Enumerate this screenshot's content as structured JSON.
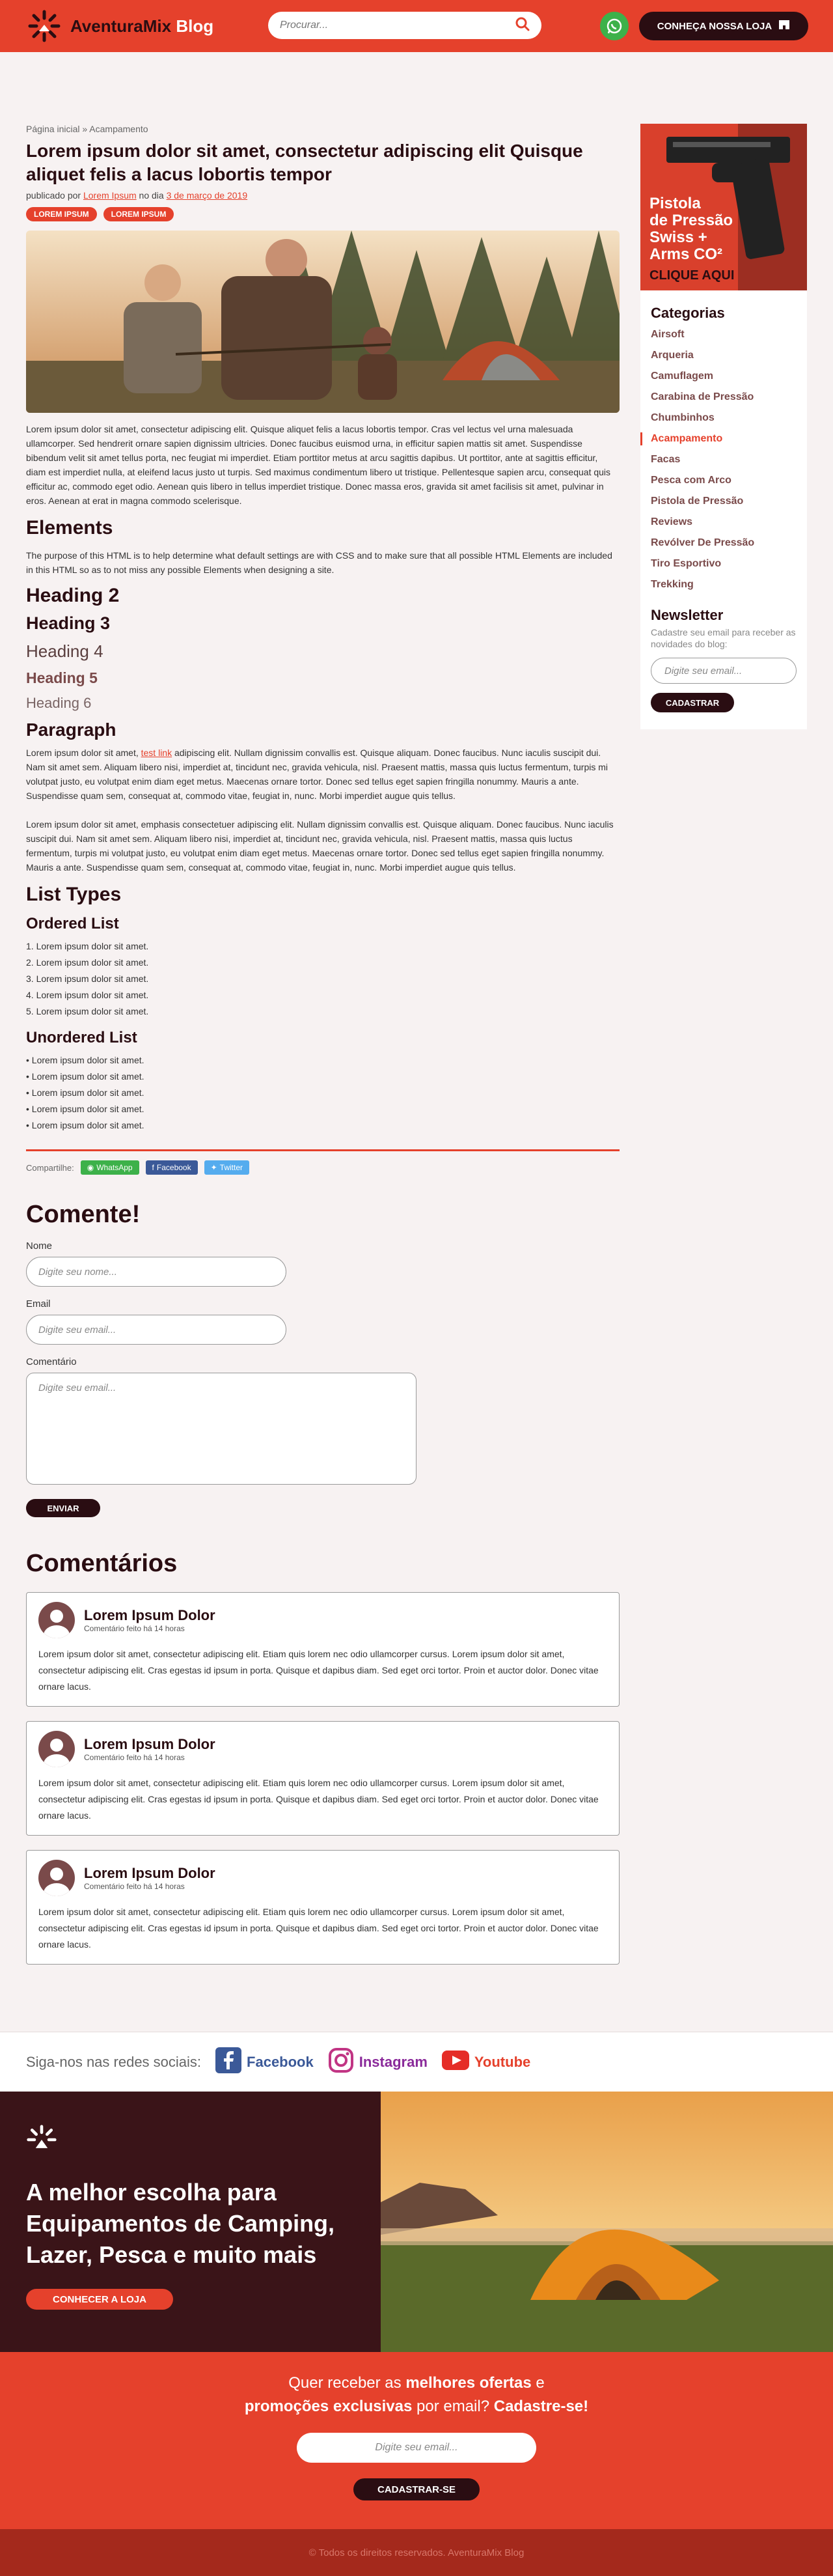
{
  "header": {
    "logo_main": "AventuraMix",
    "logo_sub": "Blog",
    "search_placeholder": "Procurar...",
    "store_button": "CONHEÇA NOSSA LOJA"
  },
  "post": {
    "breadcrumb": "Página inicial » Acampamento",
    "title": "Lorem ipsum dolor sit amet, consectetur adipiscing elit Quisque aliquet felis a lacus lobortis tempor",
    "published_prefix": "publicado por",
    "author": "Lorem Ipsum",
    "date_prefix": "no dia",
    "date": "3 de março de 2019",
    "tags": [
      "LOREM IPSUM",
      "LOREM IPSUM"
    ],
    "intro": "Lorem ipsum dolor sit amet, consectetur adipiscing elit. Quisque aliquet felis a lacus lobortis tempor. Cras vel lectus vel urna malesuada ullamcorper. Sed hendrerit ornare sapien dignissim ultricies. Donec faucibus euismod urna, in efficitur sapien mattis sit amet. Suspendisse bibendum velit sit amet tellus porta, nec feugiat mi imperdiet. Etiam porttitor metus at arcu sagittis dapibus. Ut porttitor, ante at sagittis efficitur, diam est imperdiet nulla, at eleifend lacus justo ut turpis. Sed maximus condimentum libero ut tristique. Pellentesque sapien arcu, consequat quis efficitur ac, commodo eget odio. Aenean quis libero in tellus imperdiet tristique. Donec massa eros, gravida sit amet facilisis sit amet, pulvinar in eros. Aenean at erat in magna commodo scelerisque.",
    "elements_heading": "Elements",
    "elements_text": "The purpose of this HTML is to help determine what default settings are with CSS and to make sure that all possible HTML Elements are included in this HTML so as to not miss any possible Elements when designing a site.",
    "h2": "Heading 2",
    "h3": "Heading 3",
    "h4": "Heading 4",
    "h5": "Heading 5",
    "h6": "Heading 6",
    "paragraph_heading": "Paragraph",
    "para1_before": "Lorem ipsum dolor sit amet,",
    "para1_link": "test link",
    "para1_after": "adipiscing elit. Nullam dignissim convallis est. Quisque aliquam. Donec faucibus. Nunc iaculis suscipit dui. Nam sit amet sem. Aliquam libero nisi, imperdiet at, tincidunt nec, gravida vehicula, nisl. Praesent mattis, massa quis luctus fermentum, turpis mi volutpat justo, eu volutpat enim diam eget metus. Maecenas ornare tortor. Donec sed tellus eget sapien fringilla nonummy. Mauris a ante. Suspendisse quam sem, consequat at, commodo vitae, feugiat in, nunc. Morbi imperdiet augue quis tellus.",
    "para2": "Lorem ipsum dolor sit amet, emphasis consectetuer adipiscing elit. Nullam dignissim convallis est. Quisque aliquam. Donec faucibus. Nunc iaculis suscipit dui. Nam sit amet sem. Aliquam libero nisi, imperdiet at, tincidunt nec, gravida vehicula, nisl. Praesent mattis, massa quis luctus fermentum, turpis mi volutpat justo, eu volutpat enim diam eget metus. Maecenas ornare tortor. Donec sed tellus eget sapien fringilla nonummy. Mauris a ante. Suspendisse quam sem, consequat at, commodo vitae, feugiat in, nunc. Morbi imperdiet augue quis tellus.",
    "list_types": "List Types",
    "ordered_heading": "Ordered List",
    "ordered": [
      "1. Lorem ipsum dolor sit amet.",
      "2. Lorem ipsum dolor sit amet.",
      "3. Lorem ipsum dolor sit amet.",
      "4. Lorem ipsum dolor sit amet.",
      "5. Lorem ipsum dolor sit amet."
    ],
    "unordered_heading": "Unordered List",
    "unordered": [
      "• Lorem ipsum dolor sit amet.",
      "• Lorem ipsum dolor sit amet.",
      "• Lorem ipsum dolor sit amet.",
      "• Lorem ipsum dolor sit amet.",
      "• Lorem ipsum dolor sit amet."
    ]
  },
  "share": {
    "label": "Compartilhe:",
    "whatsapp": "WhatsApp",
    "facebook": "Facebook",
    "twitter": "Twitter"
  },
  "comment_form": {
    "heading": "Comente!",
    "name_label": "Nome",
    "name_placeholder": "Digite seu nome...",
    "email_label": "Email",
    "email_placeholder": "Digite seu email...",
    "comment_label": "Comentário",
    "comment_placeholder": "Digite seu email...",
    "submit": "ENVIAR"
  },
  "comments": {
    "heading": "Comentários",
    "items": [
      {
        "name": "Lorem Ipsum Dolor",
        "time": "Comentário feito há 14 horas",
        "text": "Lorem ipsum dolor sit amet, consectetur adipiscing elit. Etiam quis lorem nec odio ullamcorper cursus. Lorem ipsum dolor sit amet, consectetur adipiscing elit. Cras egestas id ipsum in porta. Quisque et dapibus diam. Sed eget orci tortor. Proin et auctor dolor. Donec vitae ornare lacus."
      },
      {
        "name": "Lorem Ipsum Dolor",
        "time": "Comentário feito há 14 horas",
        "text": "Lorem ipsum dolor sit amet, consectetur adipiscing elit. Etiam quis lorem nec odio ullamcorper cursus. Lorem ipsum dolor sit amet, consectetur adipiscing elit. Cras egestas id ipsum in porta. Quisque et dapibus diam. Sed eget orci tortor. Proin et auctor dolor. Donec vitae ornare lacus."
      },
      {
        "name": "Lorem Ipsum Dolor",
        "time": "Comentário feito há 14 horas",
        "text": "Lorem ipsum dolor sit amet, consectetur adipiscing elit. Etiam quis lorem nec odio ullamcorper cursus. Lorem ipsum dolor sit amet, consectetur adipiscing elit. Cras egestas id ipsum in porta. Quisque et dapibus diam. Sed eget orci tortor. Proin et auctor dolor. Donec vitae ornare lacus."
      }
    ]
  },
  "sidebar": {
    "ad_line1": "Pistola",
    "ad_line2": "de Pressão",
    "ad_line3": "Swiss +",
    "ad_line4": "Arms CO²",
    "ad_cta": "CLIQUE AQUI",
    "categories_heading": "Categorias",
    "categories": [
      "Airsoft",
      "Arqueria",
      "Camuflagem",
      "Carabina de Pressão",
      "Chumbinhos",
      "Acampamento",
      "Facas",
      "Pesca com Arco",
      "Pistola de Pressão",
      "Reviews",
      "Revólver De Pressão",
      "Tiro Esportivo",
      "Trekking"
    ],
    "active_category": "Acampamento",
    "newsletter_heading": "Newsletter",
    "newsletter_text": "Cadastre seu email para receber as novidades do blog:",
    "newsletter_placeholder": "Digite seu email...",
    "newsletter_button": "CADASTRAR"
  },
  "follow": {
    "label": "Siga-nos nas redes sociais:",
    "facebook": "Facebook",
    "instagram": "Instagram",
    "youtube": "Youtube"
  },
  "banner": {
    "title": "A melhor escolha para Equipamentos de Camping, Lazer, Pesca e muito mais",
    "button": "CONHECER A LOJA"
  },
  "promo": {
    "line1_a": "Quer receber as",
    "line1_b": "melhores ofertas",
    "line1_c": "e",
    "line2_a": "promoções exclusivas",
    "line2_b": "por email?",
    "line2_c": "Cadastre-se!",
    "placeholder": "Digite seu email...",
    "button": "CADASTRAR-SE"
  },
  "footer": {
    "copyright": "© Todos os direitos reservados. AventuraMix Blog"
  },
  "colors": {
    "accent": "#e5412c",
    "dark": "#2a0d12",
    "whatsapp": "#3db14a",
    "facebook": "#3b5998",
    "twitter": "#55acee"
  }
}
